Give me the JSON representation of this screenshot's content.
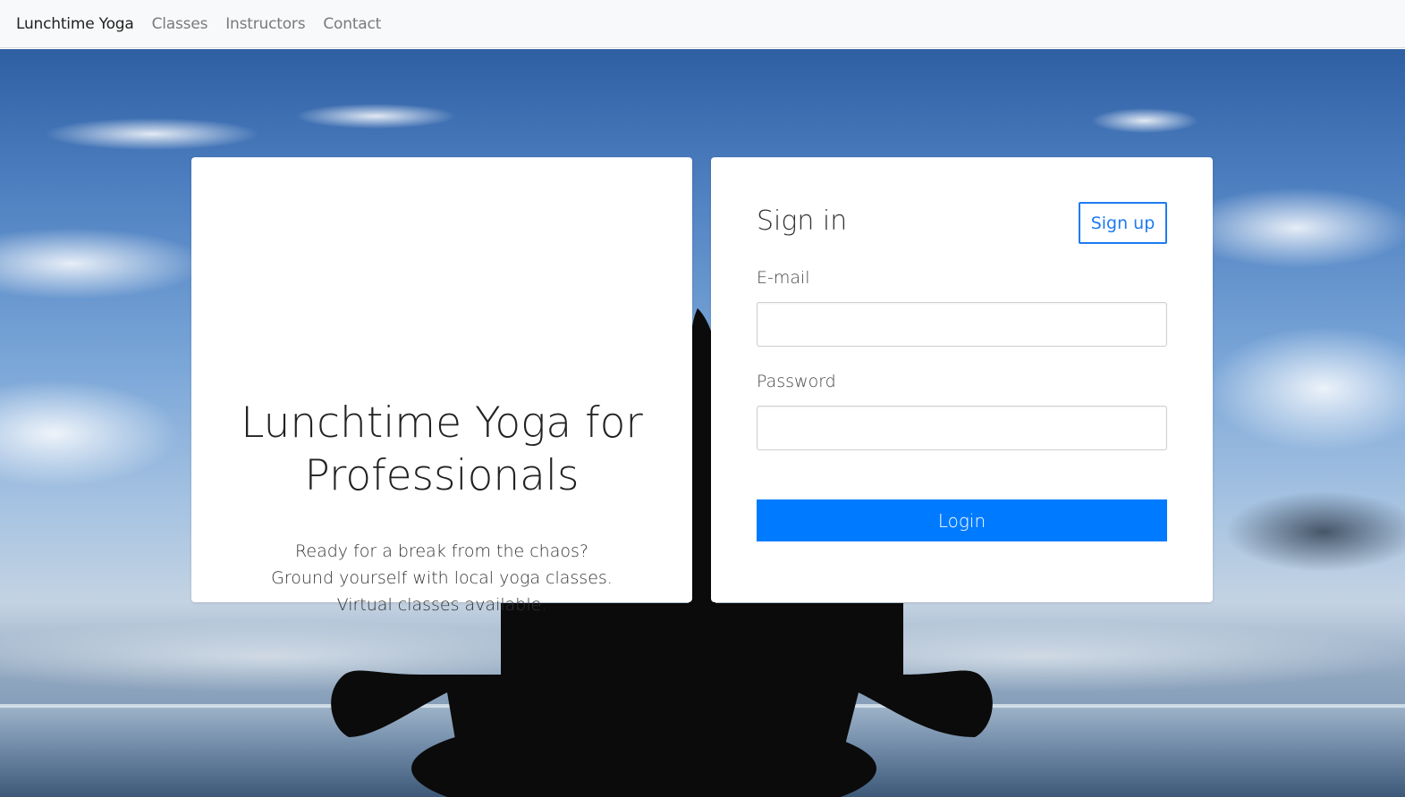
{
  "navbar": {
    "brand": "Lunchtime Yoga",
    "links": [
      "Classes",
      "Instructors",
      "Contact"
    ]
  },
  "hero": {
    "title": "Lunchtime Yoga for Professionals",
    "lines": [
      "Ready for a break from the chaos?",
      "Ground yourself with local yoga classes.",
      "Virtual classes available."
    ]
  },
  "signin": {
    "title": "Sign in",
    "signup_label": "Sign up",
    "email_label": "E-mail",
    "email_value": "",
    "password_label": "Password",
    "password_value": "",
    "login_label": "Login"
  },
  "colors": {
    "primary": "#007bff",
    "outline": "#1e7bf0",
    "navbar_bg": "#f8f9fa"
  }
}
